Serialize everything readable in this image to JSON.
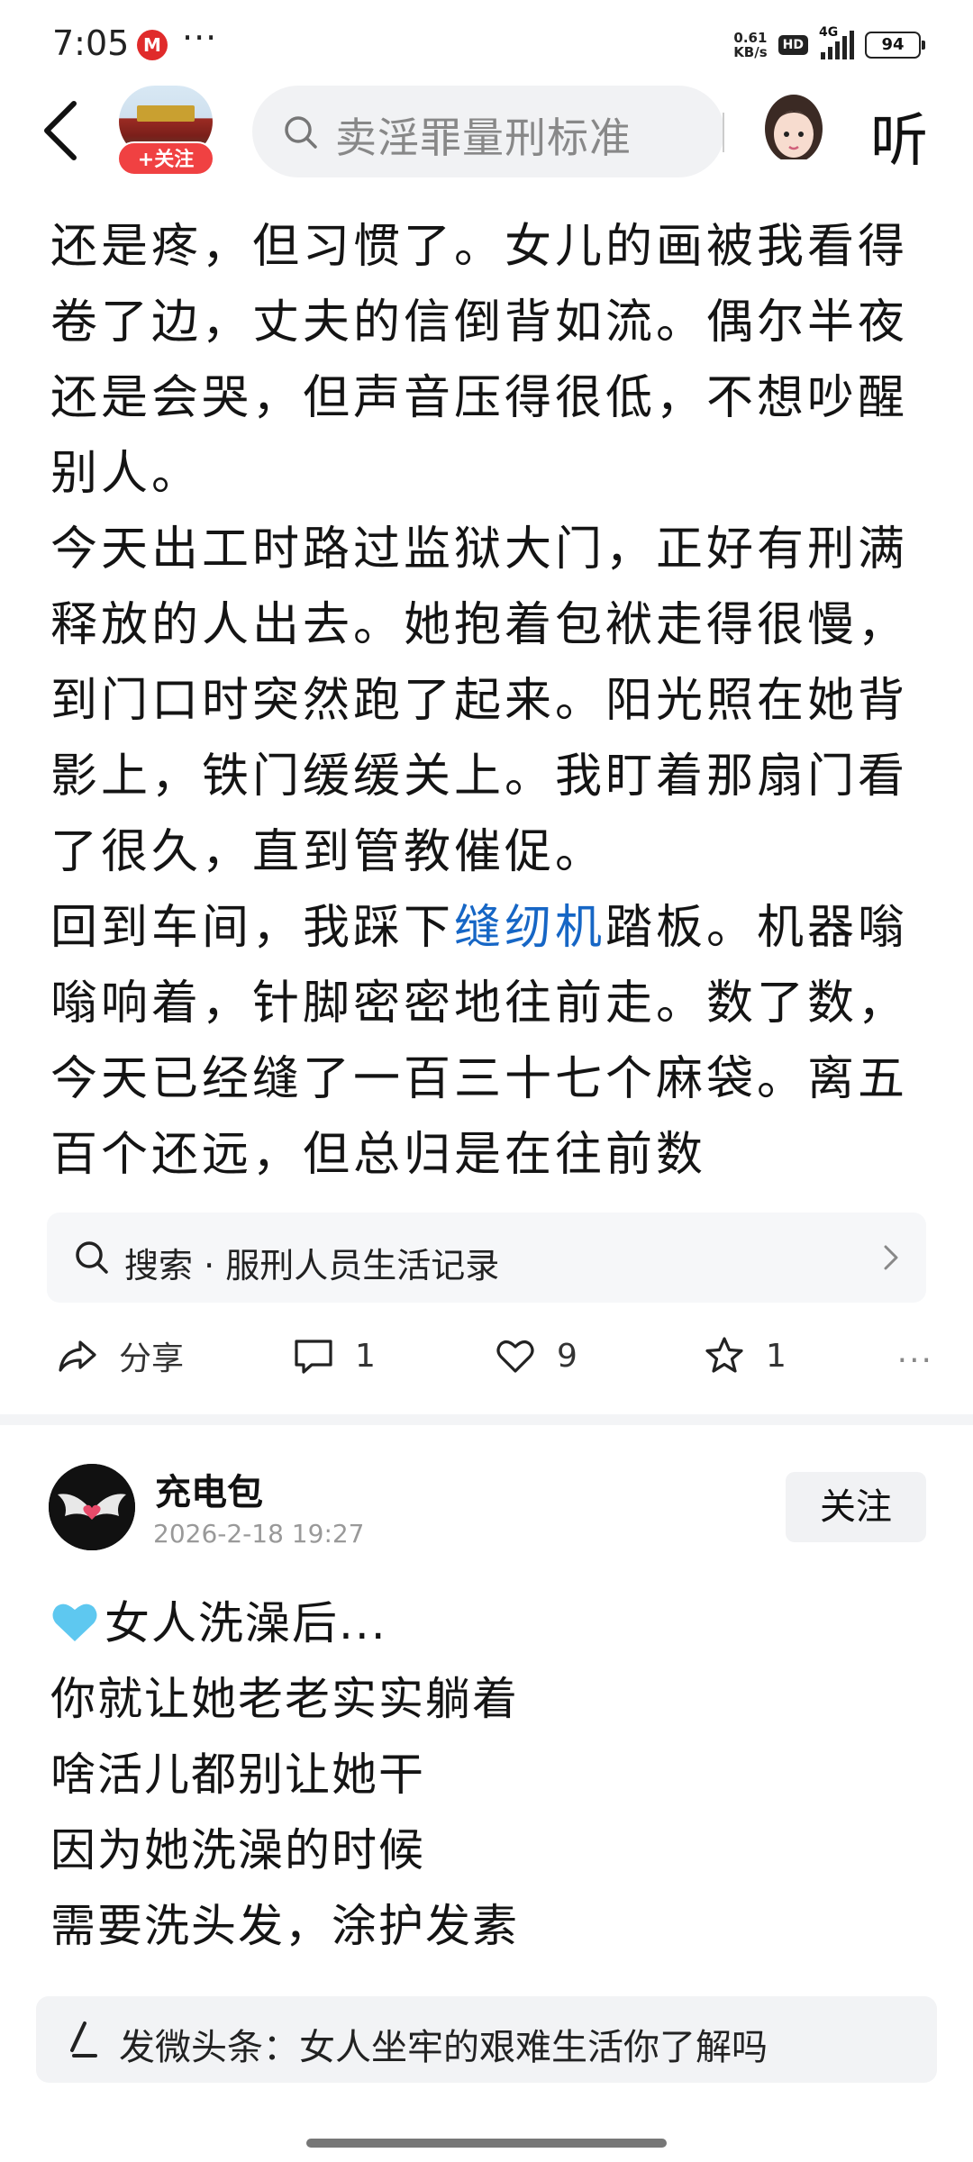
{
  "status_bar": {
    "time": "7:05",
    "dots": "···",
    "net_speed_value": "0.61",
    "net_speed_unit": "KB/s",
    "hd": "HD",
    "net_type": "4G",
    "battery": "94"
  },
  "nav": {
    "follow_label": "+关注",
    "search_placeholder": "卖淫罪量刑标准",
    "listen_label": "听"
  },
  "article": {
    "paragraphs": [
      "还是疼，但习惯了。女儿的画被我看得卷了边，丈夫的信倒背如流。偶尔半夜还是会哭，但声音压得很低，不想吵醒别人。",
      "今天出工时路过监狱大门，正好有刑满释放的人出去。她抱着包袱走得很慢，到门口时突然跑了起来。阳光照在她背影上，铁门缓缓关上。我盯着那扇门看了很久，直到管教催促。"
    ],
    "p3_before": "回到车间，我踩下",
    "p3_link": "缝纫机",
    "p3_after": "踏板。机器嗡嗡响着，针脚密密地往前走。数了数，今天已经缝了一百三十七个麻袋。离五百个还远，但总归是在往前数"
  },
  "search_suggest": {
    "text": "搜索 · 服刑人员生活记录"
  },
  "actions": {
    "share": "分享",
    "comments": "1",
    "likes": "9",
    "favorites": "1",
    "more": "···"
  },
  "post2": {
    "author": "充电包",
    "time": "2026-2-18 19:27",
    "follow": "关注",
    "lines": [
      "女人洗澡后...",
      "你就让她老老实实躺着",
      "啥活儿都别让她干",
      "因为她洗澡的时候",
      "需要洗头发，涂护发素"
    ]
  },
  "compose": {
    "text": "发微头条：女人坐牢的艰难生活你了解吗"
  },
  "colors": {
    "link": "#1666c5",
    "follow_pill": "#f04142",
    "heart_emoji": "#5ec8f0"
  }
}
